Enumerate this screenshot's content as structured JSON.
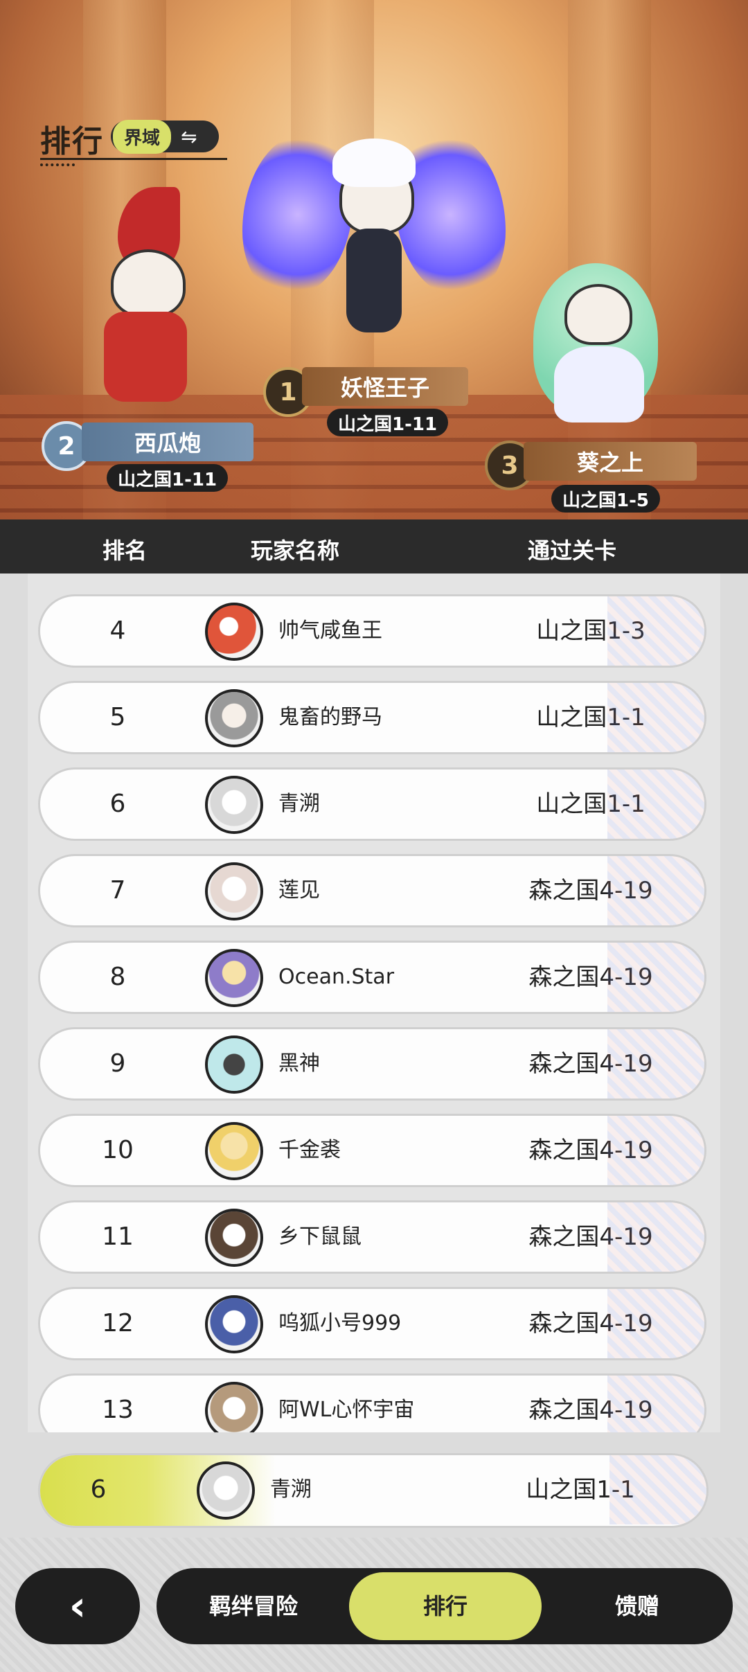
{
  "header": {
    "title": "排行",
    "domain_label": "界域",
    "swap_icon": "⇋"
  },
  "podium": [
    {
      "rank": "1",
      "name": "妖怪王子",
      "stage": "山之国1-11"
    },
    {
      "rank": "2",
      "name": "西瓜炮",
      "stage": "山之国1-11"
    },
    {
      "rank": "3",
      "name": "葵之上",
      "stage": "山之国1-5"
    }
  ],
  "columns": {
    "rank": "排名",
    "player": "玩家名称",
    "stage": "通过关卡"
  },
  "rows": [
    {
      "rank": "4",
      "name": "帅气咸鱼王",
      "stage": "山之国1-3"
    },
    {
      "rank": "5",
      "name": "鬼畜的野马",
      "stage": "山之国1-1"
    },
    {
      "rank": "6",
      "name": "青溯",
      "stage": "山之国1-1"
    },
    {
      "rank": "7",
      "name": "莲见",
      "stage": "森之国4-19"
    },
    {
      "rank": "8",
      "name": "Ocean.Star",
      "stage": "森之国4-19"
    },
    {
      "rank": "9",
      "name": "黑神",
      "stage": "森之国4-19"
    },
    {
      "rank": "10",
      "name": "千金裘",
      "stage": "森之国4-19"
    },
    {
      "rank": "11",
      "name": "乡下鼠鼠",
      "stage": "森之国4-19"
    },
    {
      "rank": "12",
      "name": "呜狐小号999",
      "stage": "森之国4-19"
    },
    {
      "rank": "13",
      "name": "阿WL心怀宇宙",
      "stage": "森之国4-19"
    }
  ],
  "my_rank": {
    "rank": "6",
    "name": "青溯",
    "stage": "山之国1-1"
  },
  "nav": {
    "back_icon": "‹",
    "items": [
      "羁绊冒险",
      "排行",
      "馈赠"
    ],
    "active": "排行"
  },
  "colors": {
    "accent": "#d9df6a",
    "dark": "#1f1f1f",
    "header_bar": "#2b2b2b"
  }
}
